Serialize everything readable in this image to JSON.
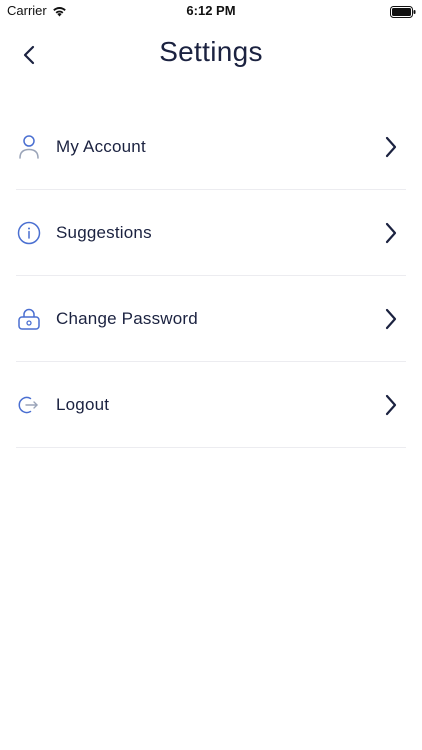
{
  "status_bar": {
    "carrier": "Carrier",
    "time": "6:12 PM"
  },
  "header": {
    "title": "Settings",
    "back_icon": "chevron-left-icon"
  },
  "settings": {
    "items": [
      {
        "label": "My Account",
        "icon": "user-icon"
      },
      {
        "label": "Suggestions",
        "icon": "info-icon"
      },
      {
        "label": "Change Password",
        "icon": "lock-icon"
      },
      {
        "label": "Logout",
        "icon": "logout-icon"
      }
    ]
  },
  "colors": {
    "accent": "#4a6fd1",
    "text": "#1b2240",
    "divider": "#ececf0"
  }
}
